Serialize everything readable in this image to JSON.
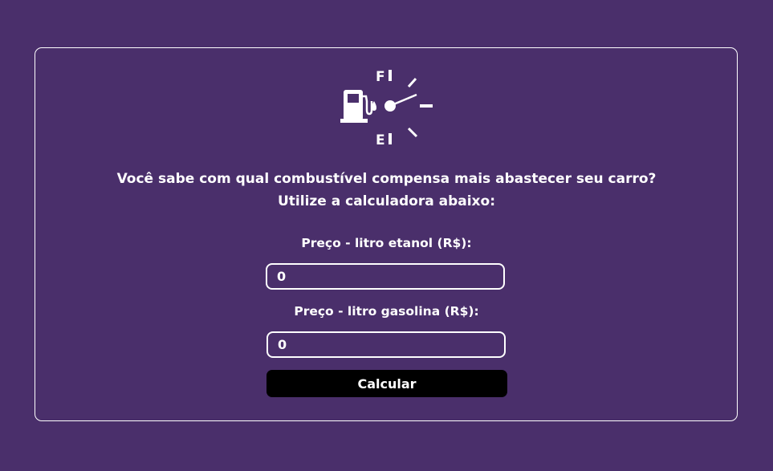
{
  "logo": {
    "icon": "fuel-gauge-icon",
    "full_mark": "F",
    "empty_mark": "E"
  },
  "question": {
    "line1": "Você sabe com qual combustível compensa mais abastecer seu carro?",
    "line2": "Utilize a calculadora abaixo:"
  },
  "form": {
    "etanol_label": "Preço - litro etanol (R$):",
    "etanol_value": "0",
    "gasolina_label": "Preço - litro gasolina (R$):",
    "gasolina_value": "0",
    "submit_label": "Calcular"
  },
  "colors": {
    "background": "#4a2f6b",
    "foreground": "#ffffff",
    "button": "#000000"
  }
}
